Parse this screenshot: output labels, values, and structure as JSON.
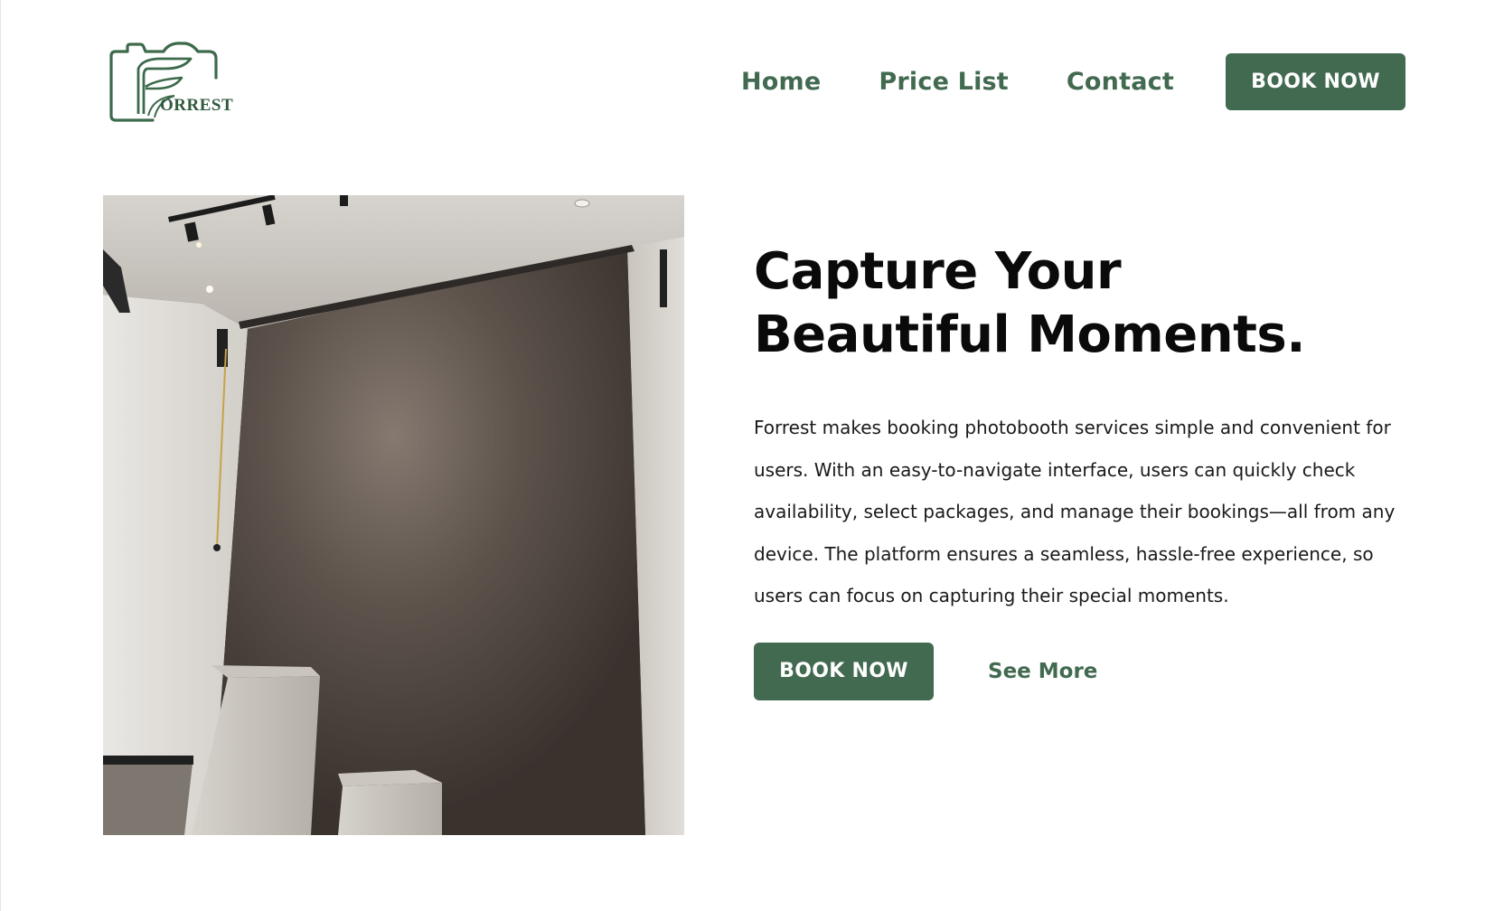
{
  "brand": {
    "logo_text": "ORREST",
    "logo_initial": "F",
    "accent_color": "#426a50"
  },
  "nav": {
    "items": [
      {
        "label": "Home"
      },
      {
        "label": "Price List"
      },
      {
        "label": "Contact"
      }
    ],
    "cta_label": "BOOK NOW"
  },
  "hero": {
    "title_line1": "Capture Your",
    "title_line2": "Beautiful Moments.",
    "description": "Forrest makes booking photobooth services simple and convenient for users. With an easy-to-navigate interface, users can quickly check availability, select packages, and manage their bookings—all from any device. The platform ensures a seamless, hassle-free experience, so users can focus on capturing their special moments.",
    "primary_cta": "BOOK NOW",
    "secondary_cta": "See More"
  }
}
